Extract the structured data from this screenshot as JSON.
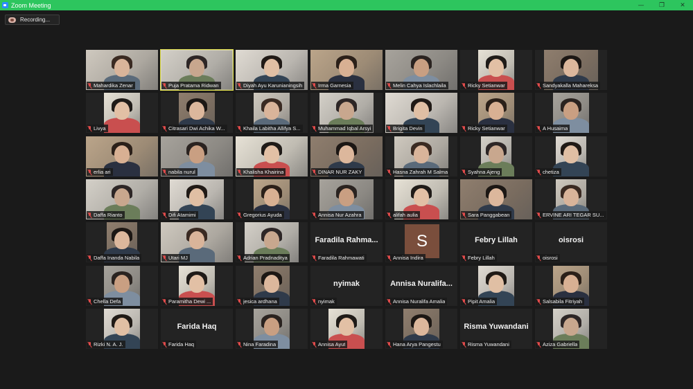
{
  "window": {
    "title": "Zoom Meeting",
    "controls": {
      "minimize": "—",
      "maximize": "❐",
      "close": "✕"
    },
    "accent_color": "#2dc55e"
  },
  "recording": {
    "label": "Recording..."
  },
  "participants": [
    {
      "name": "Mahardika Zenar",
      "video": true
    },
    {
      "name": "Puja Pratama Ridwan",
      "video": true,
      "active": true
    },
    {
      "name": "Diyah Ayu Karunianingsih",
      "video": true
    },
    {
      "name": "Irma Garnesia",
      "video": true
    },
    {
      "name": "Melin Cahya Islachlaila",
      "video": true
    },
    {
      "name": "Ricky Setianwar",
      "video": true
    },
    {
      "name": "Sandyakalla Mahareksa",
      "video": true
    },
    {
      "name": "Livya",
      "video": true
    },
    {
      "name": "Citrasari Dwi Achika W...",
      "video": true
    },
    {
      "name": "Khaila Labitha Allifya S...",
      "video": true
    },
    {
      "name": "Muhammad Iqbal Arsyi",
      "video": true
    },
    {
      "name": "Brigita Devin",
      "video": true
    },
    {
      "name": "Ricky Setianwar",
      "video": true
    },
    {
      "name": "A Husaima",
      "video": true
    },
    {
      "name": "erlia ari",
      "video": true
    },
    {
      "name": "nabila nurul",
      "video": true
    },
    {
      "name": "Khalisha Khairina",
      "video": true
    },
    {
      "name": "DINAR NUR ZAKY",
      "video": true
    },
    {
      "name": "Hasna Zahrah M Salma",
      "video": true
    },
    {
      "name": "Syahna Ajeng",
      "video": true
    },
    {
      "name": "chetiza",
      "video": true
    },
    {
      "name": "Daffa Rianto",
      "video": true
    },
    {
      "name": "Difi Atamimi",
      "video": true
    },
    {
      "name": "Gregorius Ayuda",
      "video": true
    },
    {
      "name": "Annisa Nur Azahra",
      "video": true
    },
    {
      "name": "alifah aulia",
      "video": true
    },
    {
      "name": "Sara Panggabean",
      "video": true
    },
    {
      "name": "ERVINE ARI TEGAR SU...",
      "video": true
    },
    {
      "name": "Daffa Inanda Nabila",
      "video": true
    },
    {
      "name": "Utari MJ",
      "video": true
    },
    {
      "name": "Adrian Pradnaditya",
      "video": true
    },
    {
      "name": "Faradila Rahmawati",
      "video": false,
      "display": "Faradila Rahma..."
    },
    {
      "name": "Annisa Indira",
      "video": false,
      "avatar": "S"
    },
    {
      "name": "Febry Lillah",
      "video": false,
      "display": "Febry Lillah"
    },
    {
      "name": "oisrosi",
      "video": false,
      "display": "oisrosi"
    },
    {
      "name": "Chella Defa",
      "video": true
    },
    {
      "name": "Paramitha Dewi ...",
      "video": true
    },
    {
      "name": "jesica ardhana",
      "video": true
    },
    {
      "name": "nyimak",
      "video": false,
      "display": "nyimak"
    },
    {
      "name": "Annisa Nuralifa Amalia",
      "video": false,
      "display": "Annisa Nuralifa..."
    },
    {
      "name": "Pipit Amalia",
      "video": true
    },
    {
      "name": "Salsabila Fitriyah",
      "video": true
    },
    {
      "name": "Rizki N. A. J.",
      "video": true
    },
    {
      "name": "Farida Haq",
      "video": false,
      "display": "Farida Haq"
    },
    {
      "name": "Nina Faradina",
      "video": true
    },
    {
      "name": "Annisa Ayut",
      "video": true
    },
    {
      "name": "Hana Arya Pangestu",
      "video": true
    },
    {
      "name": "Risma Yuwandani",
      "video": false,
      "display": "Risma Yuwandani"
    },
    {
      "name": "Aziza Gabriella",
      "video": true
    }
  ]
}
